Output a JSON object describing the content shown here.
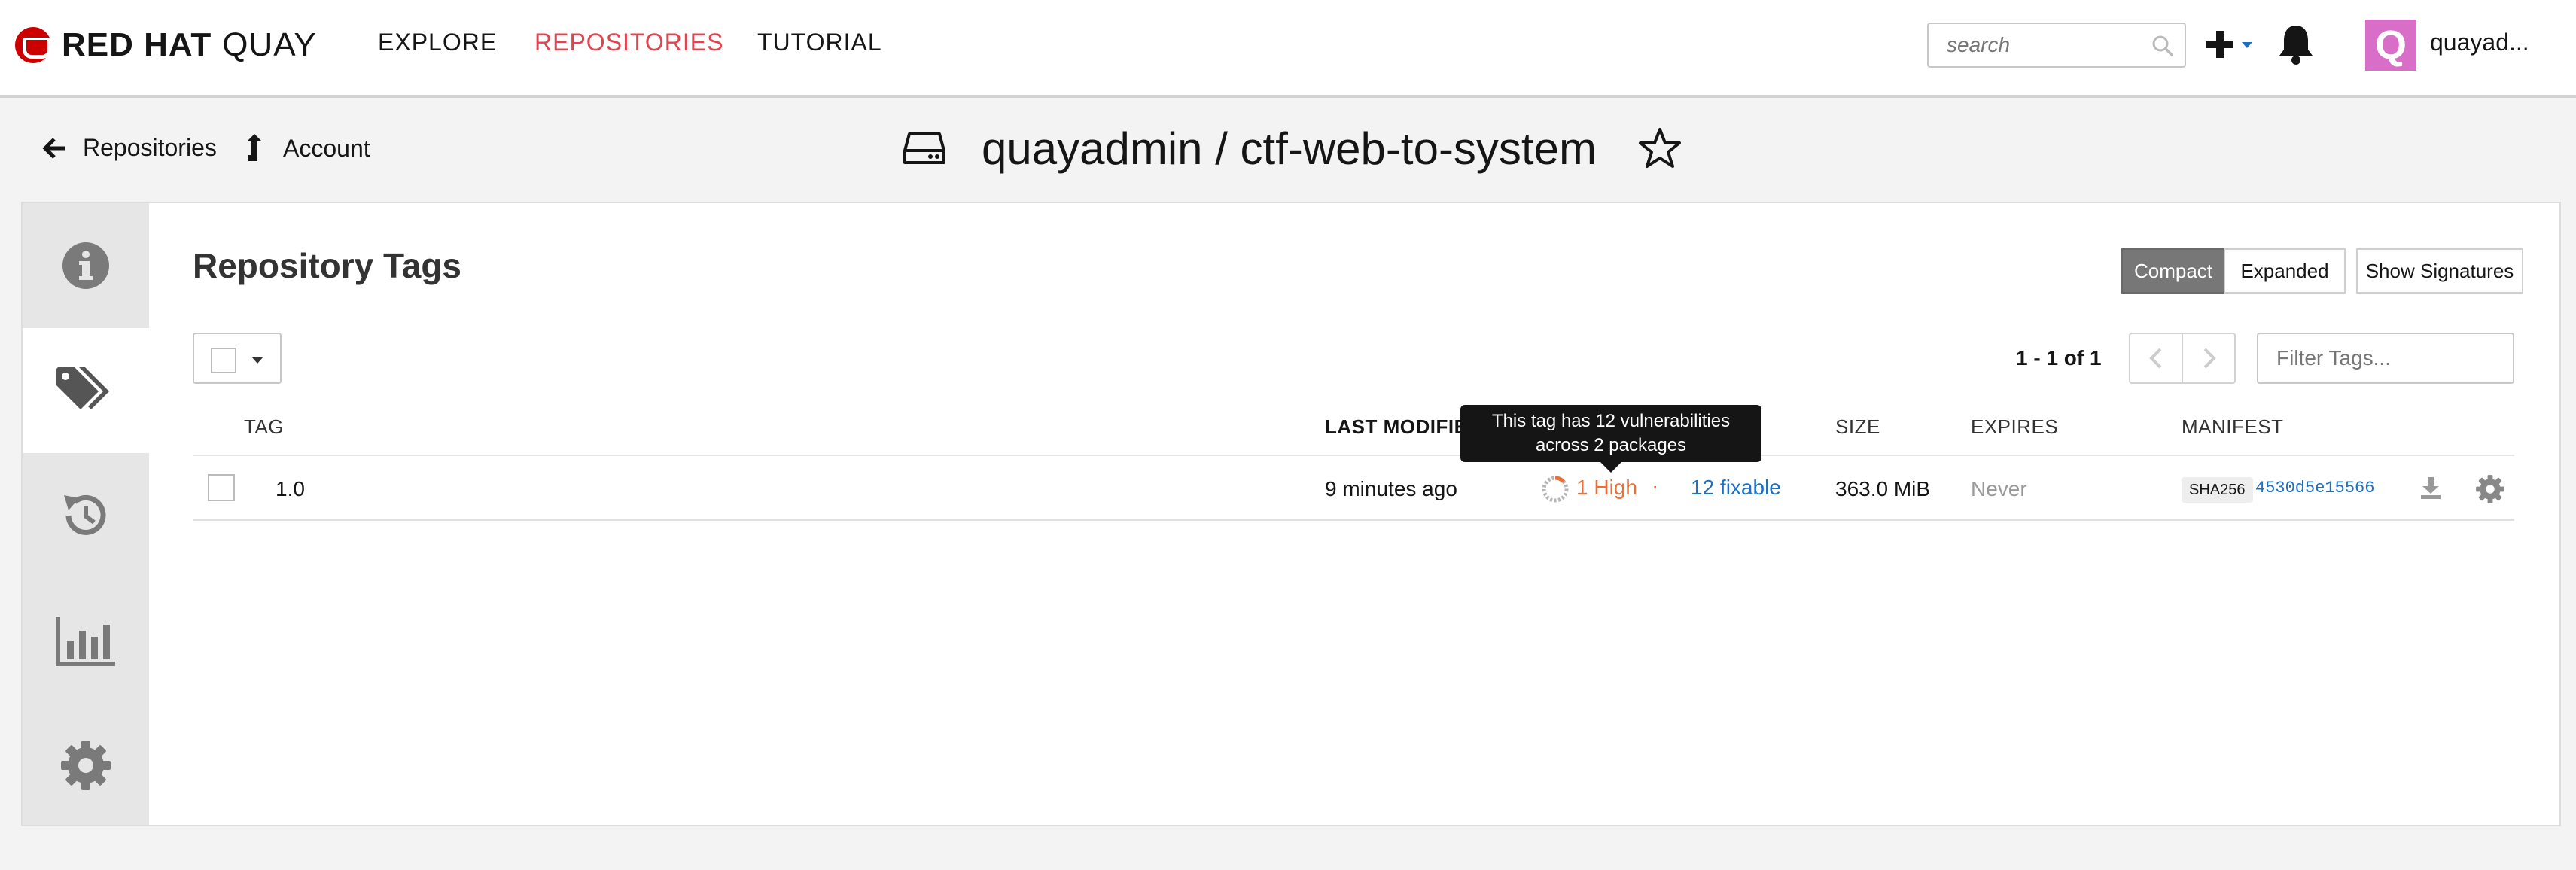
{
  "brand": {
    "name_bold": "RED HAT",
    "name_light": "QUAY"
  },
  "nav": {
    "explore": "EXPLORE",
    "repositories": "REPOSITORIES",
    "tutorial": "TUTORIAL"
  },
  "search": {
    "placeholder": "search"
  },
  "user": {
    "avatar_letter": "Q",
    "name": "quayad..."
  },
  "breadcrumb": {
    "back": "Repositories",
    "account": "Account"
  },
  "repo": {
    "title": "quayadmin / ctf-web-to-system"
  },
  "tags_view": {
    "heading": "Repository Tags",
    "views": {
      "compact": "Compact",
      "expanded": "Expanded",
      "signatures": "Show Signatures"
    },
    "paging": "1 - 1 of 1",
    "filter_placeholder": "Filter Tags...",
    "columns": {
      "tag": "TAG",
      "last_modified": "LAST MODIFIED",
      "size": "SIZE",
      "expires": "EXPIRES",
      "manifest": "MANIFEST"
    },
    "rows": [
      {
        "tag": "1.0",
        "last_modified": "9 minutes ago",
        "vuln_high": "1 High",
        "vuln_sep": "·",
        "vuln_fixable": "12 fixable",
        "size": "363.0 MiB",
        "expires": "Never",
        "sha_label": "SHA256",
        "digest": "4530d5e15566"
      }
    ],
    "tooltip": {
      "line1": "This tag has 12 vulnerabilities",
      "line2": "across 2 packages"
    }
  },
  "colors": {
    "active_nav": "#e0444e",
    "vuln_high": "#e8703a",
    "link": "#1c6fc3",
    "avatar_bg": "#d96ec9"
  }
}
